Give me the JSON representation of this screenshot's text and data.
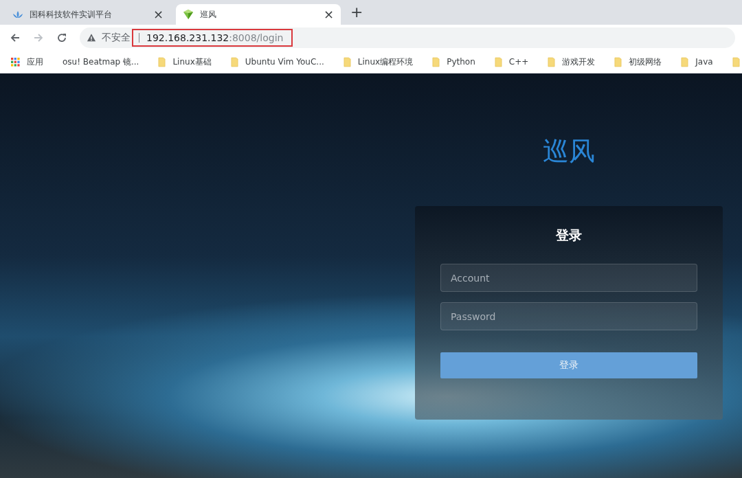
{
  "tabs": [
    {
      "title": "国科科技软件实训平台",
      "selected": false,
      "close": "×"
    },
    {
      "title": "巡风",
      "selected": true,
      "close": "×"
    }
  ],
  "new_tab": "+",
  "address_bar": {
    "security": "不安全",
    "host": "192.168.231.132",
    "path": ":8008/login",
    "highlighted": true
  },
  "bookmarks": [
    {
      "kind": "apps",
      "label": "应用"
    },
    {
      "kind": "page",
      "label": "osu! Beatmap 镜..."
    },
    {
      "kind": "folder",
      "label": "Linux基础"
    },
    {
      "kind": "folder",
      "label": "Ubuntu Vim YouC..."
    },
    {
      "kind": "folder",
      "label": "Linux编程环境"
    },
    {
      "kind": "folder",
      "label": "Python"
    },
    {
      "kind": "folder",
      "label": "C++"
    },
    {
      "kind": "folder",
      "label": "游戏开发"
    },
    {
      "kind": "folder",
      "label": "初级网络"
    },
    {
      "kind": "folder",
      "label": "Java"
    },
    {
      "kind": "folder"
    }
  ],
  "page": {
    "logo": "巡风",
    "login": {
      "title": "登录",
      "fields": [
        {
          "placeholder": "Account"
        },
        {
          "placeholder": "Password"
        }
      ],
      "button": "登录"
    }
  }
}
